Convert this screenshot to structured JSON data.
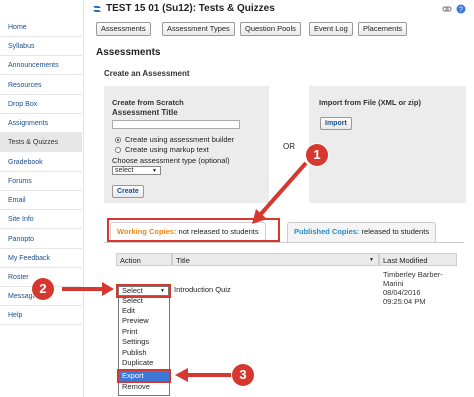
{
  "sidebar": {
    "items": [
      {
        "label": "Home"
      },
      {
        "label": "Syllabus"
      },
      {
        "label": "Announcements"
      },
      {
        "label": "Resources"
      },
      {
        "label": "Drop Box"
      },
      {
        "label": "Assignments"
      },
      {
        "label": "Tests & Quizzes",
        "active": true
      },
      {
        "label": "Gradebook"
      },
      {
        "label": "Forums"
      },
      {
        "label": "Email"
      },
      {
        "label": "Site Info"
      },
      {
        "label": "Panopto"
      },
      {
        "label": "My Feedback"
      },
      {
        "label": "Roster"
      },
      {
        "label": "Messages"
      },
      {
        "label": "Help"
      }
    ]
  },
  "header": {
    "title": "TEST 15 01 (Su12): Tests & Quizzes",
    "icons": [
      "link-icon",
      "help-icon"
    ]
  },
  "toolbar": {
    "buttons": [
      "Assessments",
      "Assessment Types",
      "Question Pools",
      "Event Log",
      "Placements"
    ]
  },
  "main": {
    "heading": "Assessments",
    "create_heading": "Create an Assessment",
    "scratch": {
      "heading": "Create from Scratch",
      "title_label": "Assessment Title",
      "title_value": "",
      "radio_builder": "Create using assessment builder",
      "radio_markup": "Create using markup text",
      "type_label": "Choose assessment type (optional)",
      "type_selected": "select",
      "create_button": "Create"
    },
    "or_label": "OR",
    "import": {
      "heading": "Import from File (XML or zip)",
      "button": "Import"
    },
    "tabs": {
      "working_prefix": "Working Copies:",
      "working_suffix": " not released to students",
      "published_prefix": "Published Copies:",
      "published_suffix": " released to students"
    },
    "table": {
      "headers": [
        "Action",
        "Title",
        "Last Modified"
      ],
      "row": {
        "action_selected": "Select",
        "title": "Introduction Quiz",
        "modified_by_1": "Timberley Barber-",
        "modified_by_2": "Marini",
        "date": "08/04/2016",
        "time": "09:25:04 PM"
      },
      "action_options": [
        "Select",
        "Edit",
        "Preview",
        "Print",
        "Settings",
        "Publish",
        "Duplicate",
        "Export",
        "Remove"
      ],
      "highlighted_option": "Export"
    }
  },
  "callouts": [
    "1",
    "2",
    "3"
  ],
  "colors": {
    "accent": "#d6372e",
    "link": "#1a4f8b",
    "working_tab": "#e8891c",
    "published_tab": "#2a8cc7",
    "highlight": "#3b78d8"
  }
}
